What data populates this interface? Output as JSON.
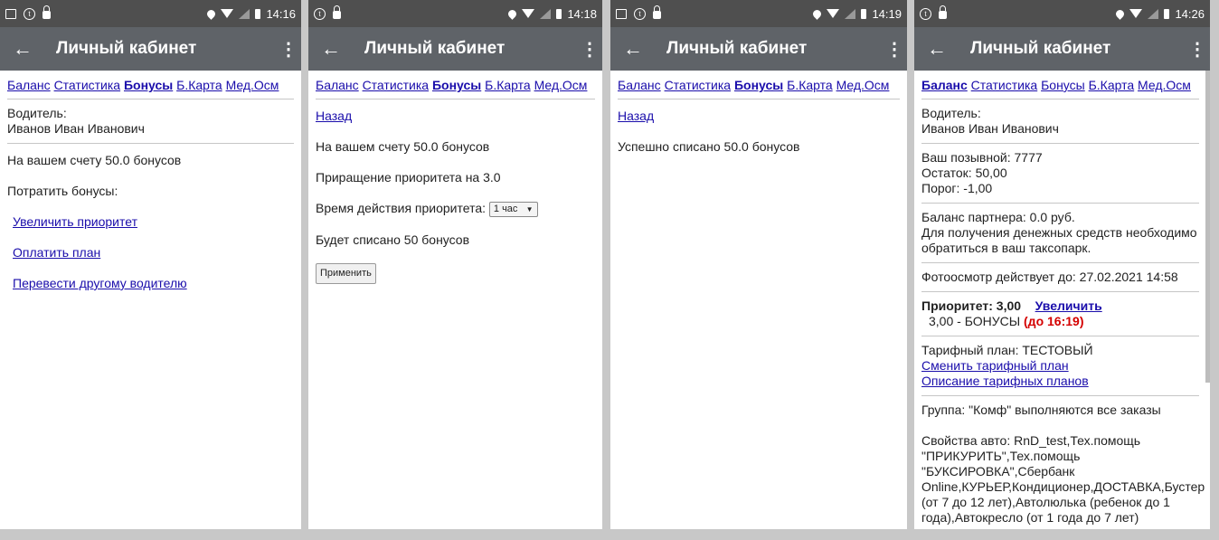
{
  "screens": [
    {
      "status": {
        "time": "14:16"
      },
      "appbar": {
        "title": "Личный кабинет"
      },
      "nav": [
        "Баланс",
        "Статистика",
        "Бонусы",
        "Б.Карта",
        "Мед.Осм"
      ],
      "driver_label": "Водитель:",
      "driver_name": "Иванов Иван Иванович",
      "bonus_balance": "На вашем счету 50.0 бонусов",
      "spend_label": "Потратить бонусы:",
      "links": [
        "Увеличить приоритет",
        "Оплатить план",
        "Перевести другому водителю"
      ]
    },
    {
      "status": {
        "time": "14:18"
      },
      "appbar": {
        "title": "Личный кабинет"
      },
      "nav": [
        "Баланс",
        "Статистика",
        "Бонусы",
        "Б.Карта",
        "Мед.Осм"
      ],
      "back_link": "Назад",
      "bonus_balance": "На вашем счету 50.0 бонусов",
      "increment": "Приращение приоритета на 3.0",
      "duration_label": "Время действия приоритета:",
      "duration_value": "1 час",
      "will_charge": "Будет списано 50 бонусов",
      "apply_button": "Применить"
    },
    {
      "status": {
        "time": "14:19"
      },
      "appbar": {
        "title": "Личный кабинет"
      },
      "nav": [
        "Баланс",
        "Статистика",
        "Бонусы",
        "Б.Карта",
        "Мед.Осм"
      ],
      "back_link": "Назад",
      "result": "Успешно списано 50.0 бонусов"
    },
    {
      "status": {
        "time": "14:26"
      },
      "appbar": {
        "title": "Личный кабинет"
      },
      "nav": [
        "Баланс",
        "Статистика",
        "Бонусы",
        "Б.Карта",
        "Мед.Осм"
      ],
      "driver_label": "Водитель:",
      "driver_name": "Иванов Иван Иванович",
      "callsign": "Ваш позывной: 7777",
      "remainder": "Остаток: 50,00",
      "threshold": "Порог: -1,00",
      "partner_balance": "Баланс партнера: 0.0 руб.",
      "partner_note": "Для получения денежных средств необходимо обратиться в ваш таксопарк.",
      "photo_check": "Фотоосмотр действует до: 27.02.2021 14:58",
      "priority_label": "Приоритет: 3,00",
      "priority_link": "Увеличить",
      "priority_detail": "3,00 - БОНУСЫ",
      "priority_until": "(до 16:19)",
      "tariff": "Тарифный план: ТЕСТОВЫЙ",
      "tariff_change": "Сменить тарифный план",
      "tariff_desc": "Описание тарифных планов",
      "group": "Группа: \"Комф\" выполняются все заказы",
      "car_props": "Свойства авто: RnD_test,Тех.помощь \"ПРИКУРИТЬ\",Тех.помощь \"БУКСИРОВКА\",Сбербанк Online,КУРЬЕР,Кондиционер,ДОСТАВКА,Бустер (от 7 до 12 лет),Автолюлька (ребенок до 1 года),Автокресло (от 1 года до 7 лет)"
    }
  ]
}
